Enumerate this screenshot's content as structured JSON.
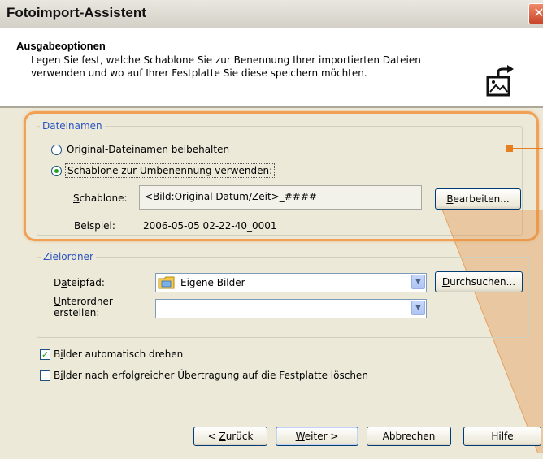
{
  "window": {
    "title": "Fotoimport-Assistent",
    "close_glyph": "✕"
  },
  "header": {
    "title": "Ausgabeoptionen",
    "desc_line1": "Legen Sie fest, welche Schablone Sie zur Benennung Ihrer importierten Dateien",
    "desc_line2": "verwenden und wo auf Ihrer Festplatte Sie diese speichern möchten.",
    "icon": "photo-export-icon"
  },
  "dateinamen": {
    "legend": "Dateinamen",
    "option_original": {
      "u": "O",
      "rest": "riginal-Dateinamen beibehalten",
      "selected": false
    },
    "option_template": {
      "u": "S",
      "rest": "chablone zur Umbenennung verwenden:",
      "selected": true
    },
    "schablone_label": {
      "u": "S",
      "rest": "chablone:"
    },
    "schablone_value": "<Bild:Original Datum/Zeit>_####",
    "edit_button": {
      "u": "B",
      "rest": "earbeiten..."
    },
    "beispiel_label": "Beispiel:",
    "beispiel_value": "2006-05-05 02-22-40_0001"
  },
  "zielordner": {
    "legend": "Zielordner",
    "dateipfad_label": {
      "pre": "D",
      "u": "a",
      "rest": "teipfad:"
    },
    "dateipfad_value": "Eigene Bilder",
    "browse_button": {
      "u": "D",
      "rest": "urchsuchen..."
    },
    "unterordner_label": {
      "u": "U",
      "rest": "nterordner",
      "line2": "erstellen:"
    },
    "unterordner_value": ""
  },
  "options": {
    "rotate": {
      "pre": "B",
      "u": "i",
      "rest": "lder automatisch drehen",
      "checked": true
    },
    "delete": {
      "pre": "B",
      "u": "i",
      "rest": "lder nach erfolgreicher Übertragung auf die Festplatte löschen",
      "checked": false
    }
  },
  "footer": {
    "back": {
      "pre": "< ",
      "u": "Z",
      "rest": "urück"
    },
    "next": {
      "u": "W",
      "rest": "eiter >"
    },
    "cancel": "Abbrechen",
    "help": "Hilfe"
  },
  "colors": {
    "accent_orange": "#f0a155",
    "legend_blue": "#2a52c2"
  }
}
